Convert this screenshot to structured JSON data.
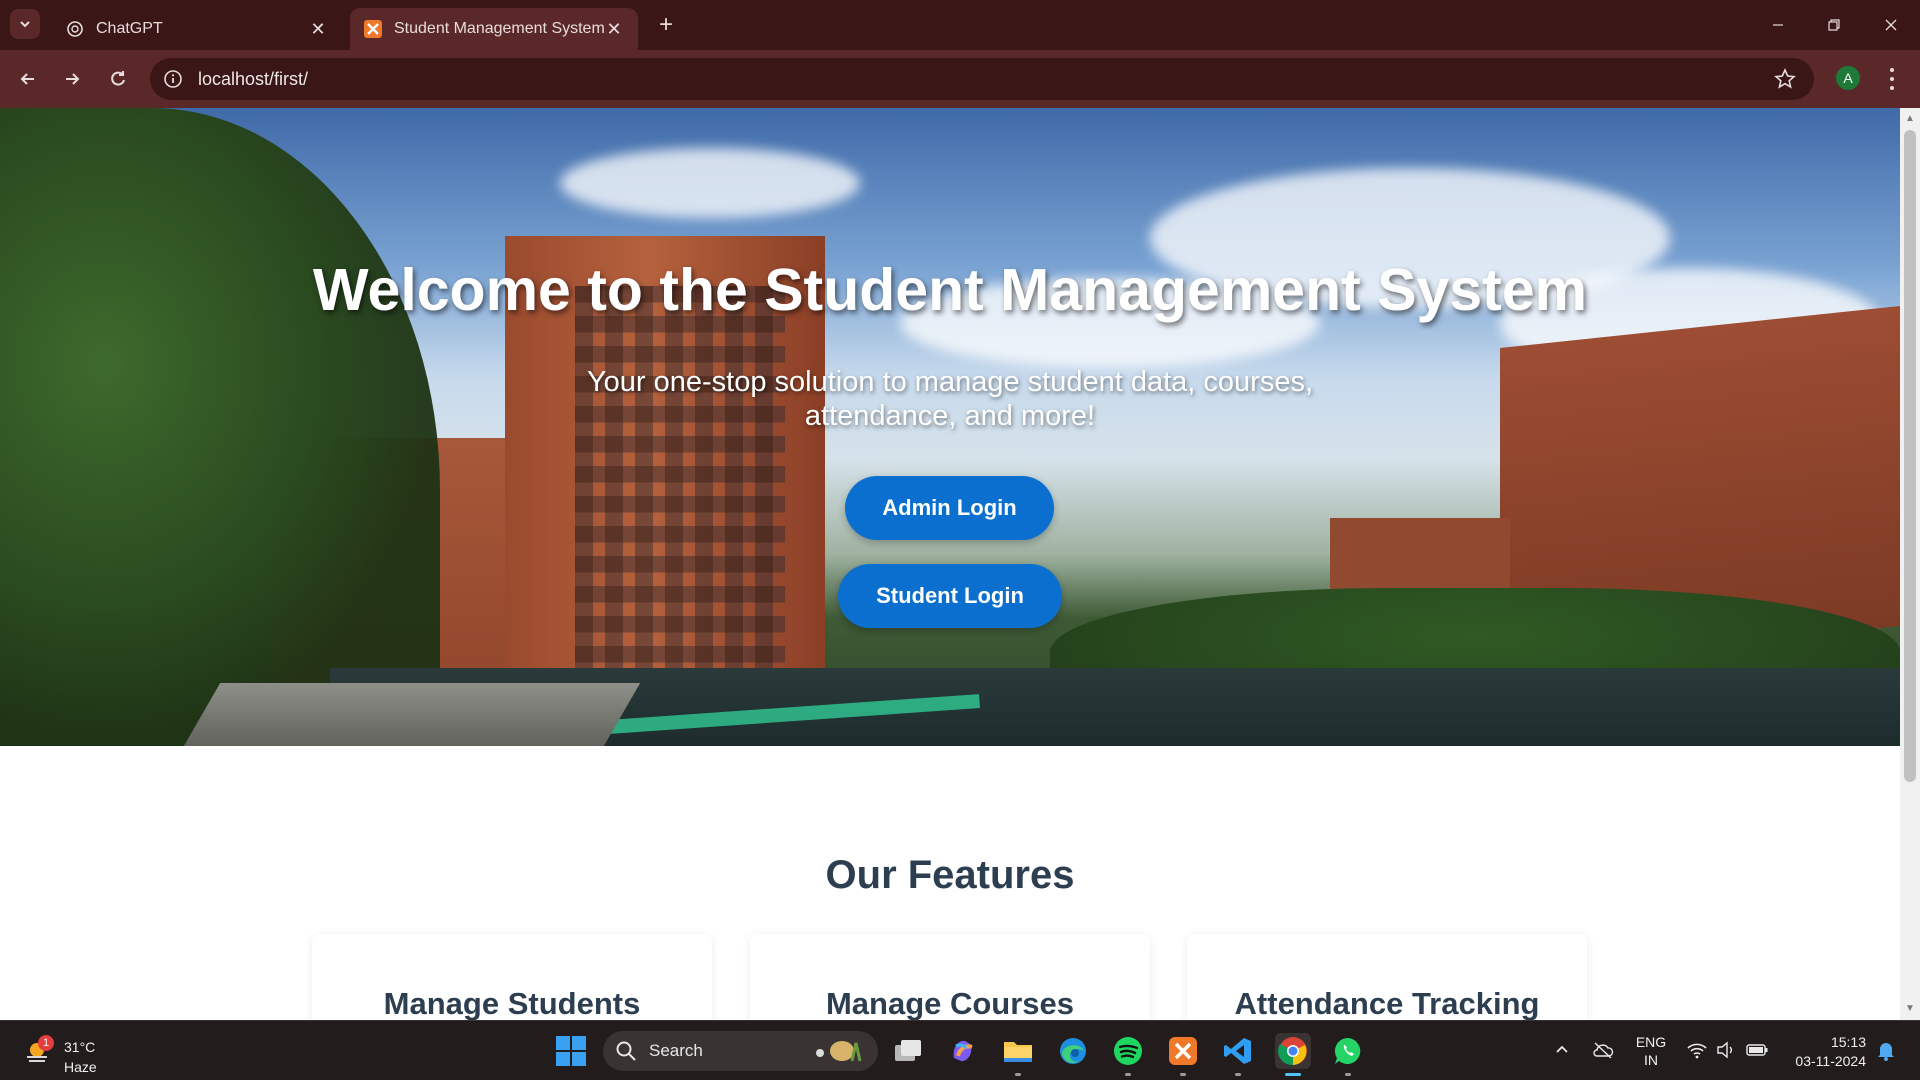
{
  "browser": {
    "tabs": [
      {
        "title": "ChatGPT",
        "active": false
      },
      {
        "title": "Student Management System -",
        "active": true
      }
    ],
    "url": "localhost/first/",
    "profile_initial": "A"
  },
  "hero": {
    "title": "Welcome to the Student Management System",
    "subtitle": "Your one-stop solution to manage student data, courses, attendance, and more!",
    "admin_button": "Admin Login",
    "student_button": "Student Login"
  },
  "features": {
    "heading": "Our Features",
    "cards": [
      {
        "title": "Manage Students"
      },
      {
        "title": "Manage Courses"
      },
      {
        "title": "Attendance Tracking"
      }
    ]
  },
  "taskbar": {
    "weather": {
      "temp": "31°C",
      "condition": "Haze",
      "badge": "1"
    },
    "search_label": "Search",
    "apps": [
      "file-explorer-icon",
      "copilot-icon",
      "folder-icon",
      "edge-icon",
      "spotify-icon",
      "xampp-icon",
      "vscode-icon",
      "chrome-icon",
      "whatsapp-icon"
    ],
    "language": {
      "line1": "ENG",
      "line2": "IN"
    },
    "clock": {
      "time": "15:13",
      "date": "03-11-2024"
    }
  },
  "colors": {
    "chrome_dark": "#3a1616",
    "chrome_toolbar": "#5a2828",
    "button_blue": "#0b6fd0",
    "heading_dark": "#2c3e50"
  }
}
